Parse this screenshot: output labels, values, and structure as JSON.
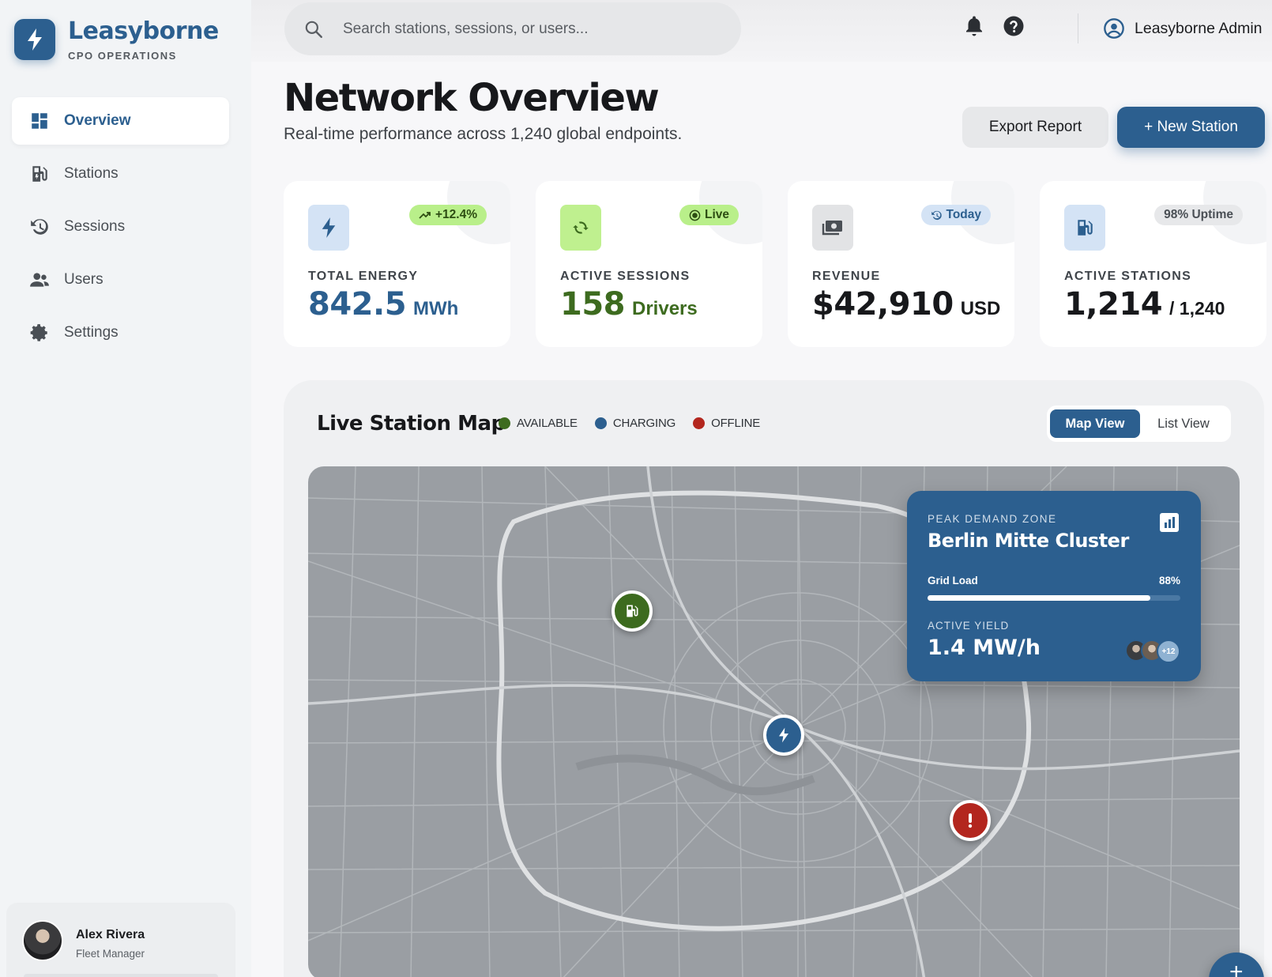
{
  "brand": {
    "name": "Leasyborne",
    "subtitle": "CPO OPERATIONS",
    "logo_icon": "bolt-icon"
  },
  "sidebar": {
    "items": [
      {
        "label": "Overview",
        "icon": "dashboard-icon",
        "active": true
      },
      {
        "label": "Stations",
        "icon": "ev-station-icon",
        "active": false
      },
      {
        "label": "Sessions",
        "icon": "history-icon",
        "active": false
      },
      {
        "label": "Users",
        "icon": "users-icon",
        "active": false
      },
      {
        "label": "Settings",
        "icon": "gear-icon",
        "active": false
      }
    ],
    "user": {
      "name": "Alex Rivera",
      "role": "Fleet Manager"
    }
  },
  "header": {
    "search_placeholder": "Search stations, sessions, or users...",
    "admin_label": "Leasyborne Admin"
  },
  "page": {
    "title": "Network Overview",
    "subtitle": "Real-time performance across 1,240 global endpoints.",
    "export_label": "Export Report",
    "new_station_label": "+ New Station"
  },
  "kpis": [
    {
      "label": "TOTAL ENERGY",
      "value": "842.5",
      "unit": "MWh",
      "badge": "+12.4%",
      "badge_icon": "trending-up-icon",
      "color": "#2c5f8f"
    },
    {
      "label": "ACTIVE SESSIONS",
      "value": "158",
      "unit": "Drivers",
      "badge": "Live",
      "badge_icon": "live-dot-icon",
      "color": "#3d6b1f"
    },
    {
      "label": "REVENUE",
      "value": "$42,910",
      "unit": "USD",
      "badge": "Today",
      "badge_icon": "history-icon",
      "color": "#17181b"
    },
    {
      "label": "ACTIVE STATIONS",
      "value": "1,214",
      "unit": "/ 1,240",
      "badge": "98% Uptime",
      "badge_icon": "",
      "color": "#17181b"
    }
  ],
  "map": {
    "title": "Live Station Map",
    "legend": [
      {
        "label": "AVAILABLE",
        "color": "#3d6b1f"
      },
      {
        "label": "CHARGING",
        "color": "#2c5f8f"
      },
      {
        "label": "OFFLINE",
        "color": "#b3261e"
      }
    ],
    "view_map": "Map View",
    "view_list": "List View",
    "zone": {
      "kicker": "PEAK DEMAND ZONE",
      "title": "Berlin Mitte Cluster",
      "grid_label": "Grid Load",
      "grid_value": "88%",
      "grid_fraction": 0.88,
      "yield_label": "ACTIVE YIELD",
      "yield_value": "1.4 MW/h",
      "more_users": "+12"
    }
  },
  "fab_label": "+"
}
